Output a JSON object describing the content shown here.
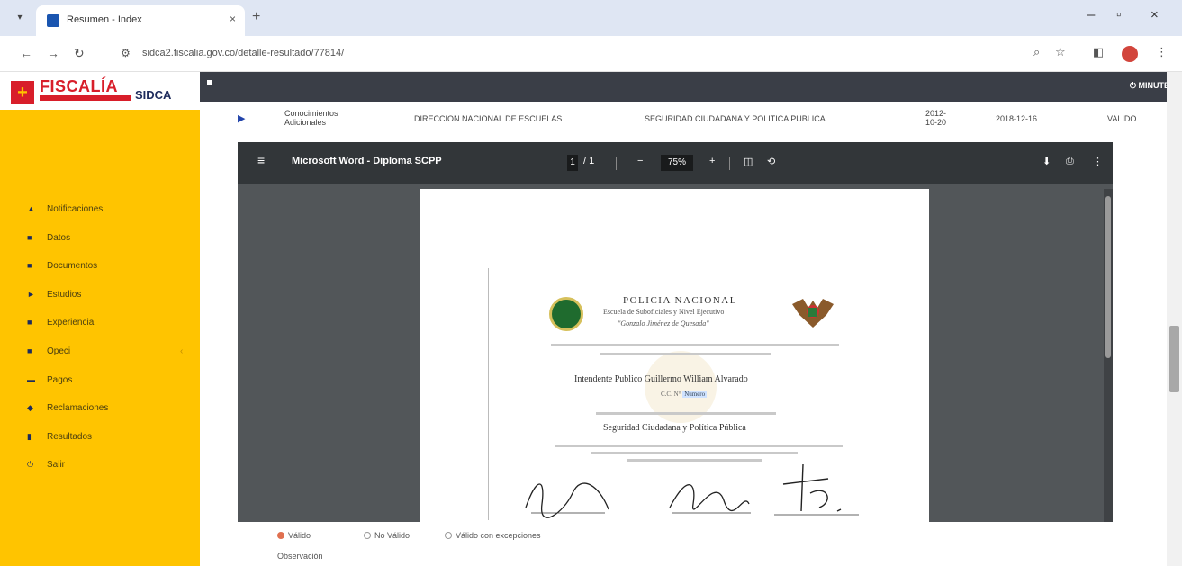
{
  "browser": {
    "tab_title": "Resumen - Index",
    "url": "sidca2.fiscalia.gov.co/detalle-resultado/77814/"
  },
  "app": {
    "logo_name": "FISCALÍA",
    "logo_product": "SIDCA",
    "brand_color": "#ffc400",
    "brand_red": "#d81e2a",
    "navbar_user": "MINUTE"
  },
  "sidebar": {
    "items": [
      {
        "label": "Notificaciones",
        "icon": "bell-icon"
      },
      {
        "label": "Datos",
        "icon": "id-icon"
      },
      {
        "label": "Documentos",
        "icon": "document-icon"
      },
      {
        "label": "Estudios",
        "icon": "graduation-icon"
      },
      {
        "label": "Experiencia",
        "icon": "briefcase-icon"
      },
      {
        "label": "Opeci",
        "icon": "folder-icon",
        "has_submenu": true
      },
      {
        "label": "Pagos",
        "icon": "card-icon"
      },
      {
        "label": "Reclamaciones",
        "icon": "megaphone-icon"
      },
      {
        "label": "Resultados",
        "icon": "bar-chart-icon"
      },
      {
        "label": "Salir",
        "icon": "power-icon"
      }
    ]
  },
  "record_row": {
    "type": "Conocimientos Adicionales",
    "institution": "DIRECCION NACIONAL DE ESCUELAS",
    "program": "SEGURIDAD CIUDADANA Y POLITICA PUBLICA",
    "start_date": "2012-10-20",
    "end_date": "2018-12-16",
    "status": "VALIDO"
  },
  "pdf_viewer": {
    "title": "Microsoft Word - Diploma SCPP",
    "page_current": "1",
    "page_total": "/ 1",
    "zoom": "75%"
  },
  "document": {
    "heading": "POLICIA NACIONAL",
    "subheading": "Escuela de Suboficiales y Nivel Ejecutivo",
    "motto": "\"Gonzalo Jiménez de Quesada\"",
    "recipient": "Intendente Publico Guillermo William Alvarado",
    "id_prefix": "C.C. N°",
    "id_number": "Numero",
    "course": "Seguridad Ciudadana y Política Pública"
  },
  "validation": {
    "options": [
      "Válido",
      "No Válido",
      "Válido con excepciones"
    ],
    "selected": "Válido",
    "observations_label": "Observación"
  }
}
